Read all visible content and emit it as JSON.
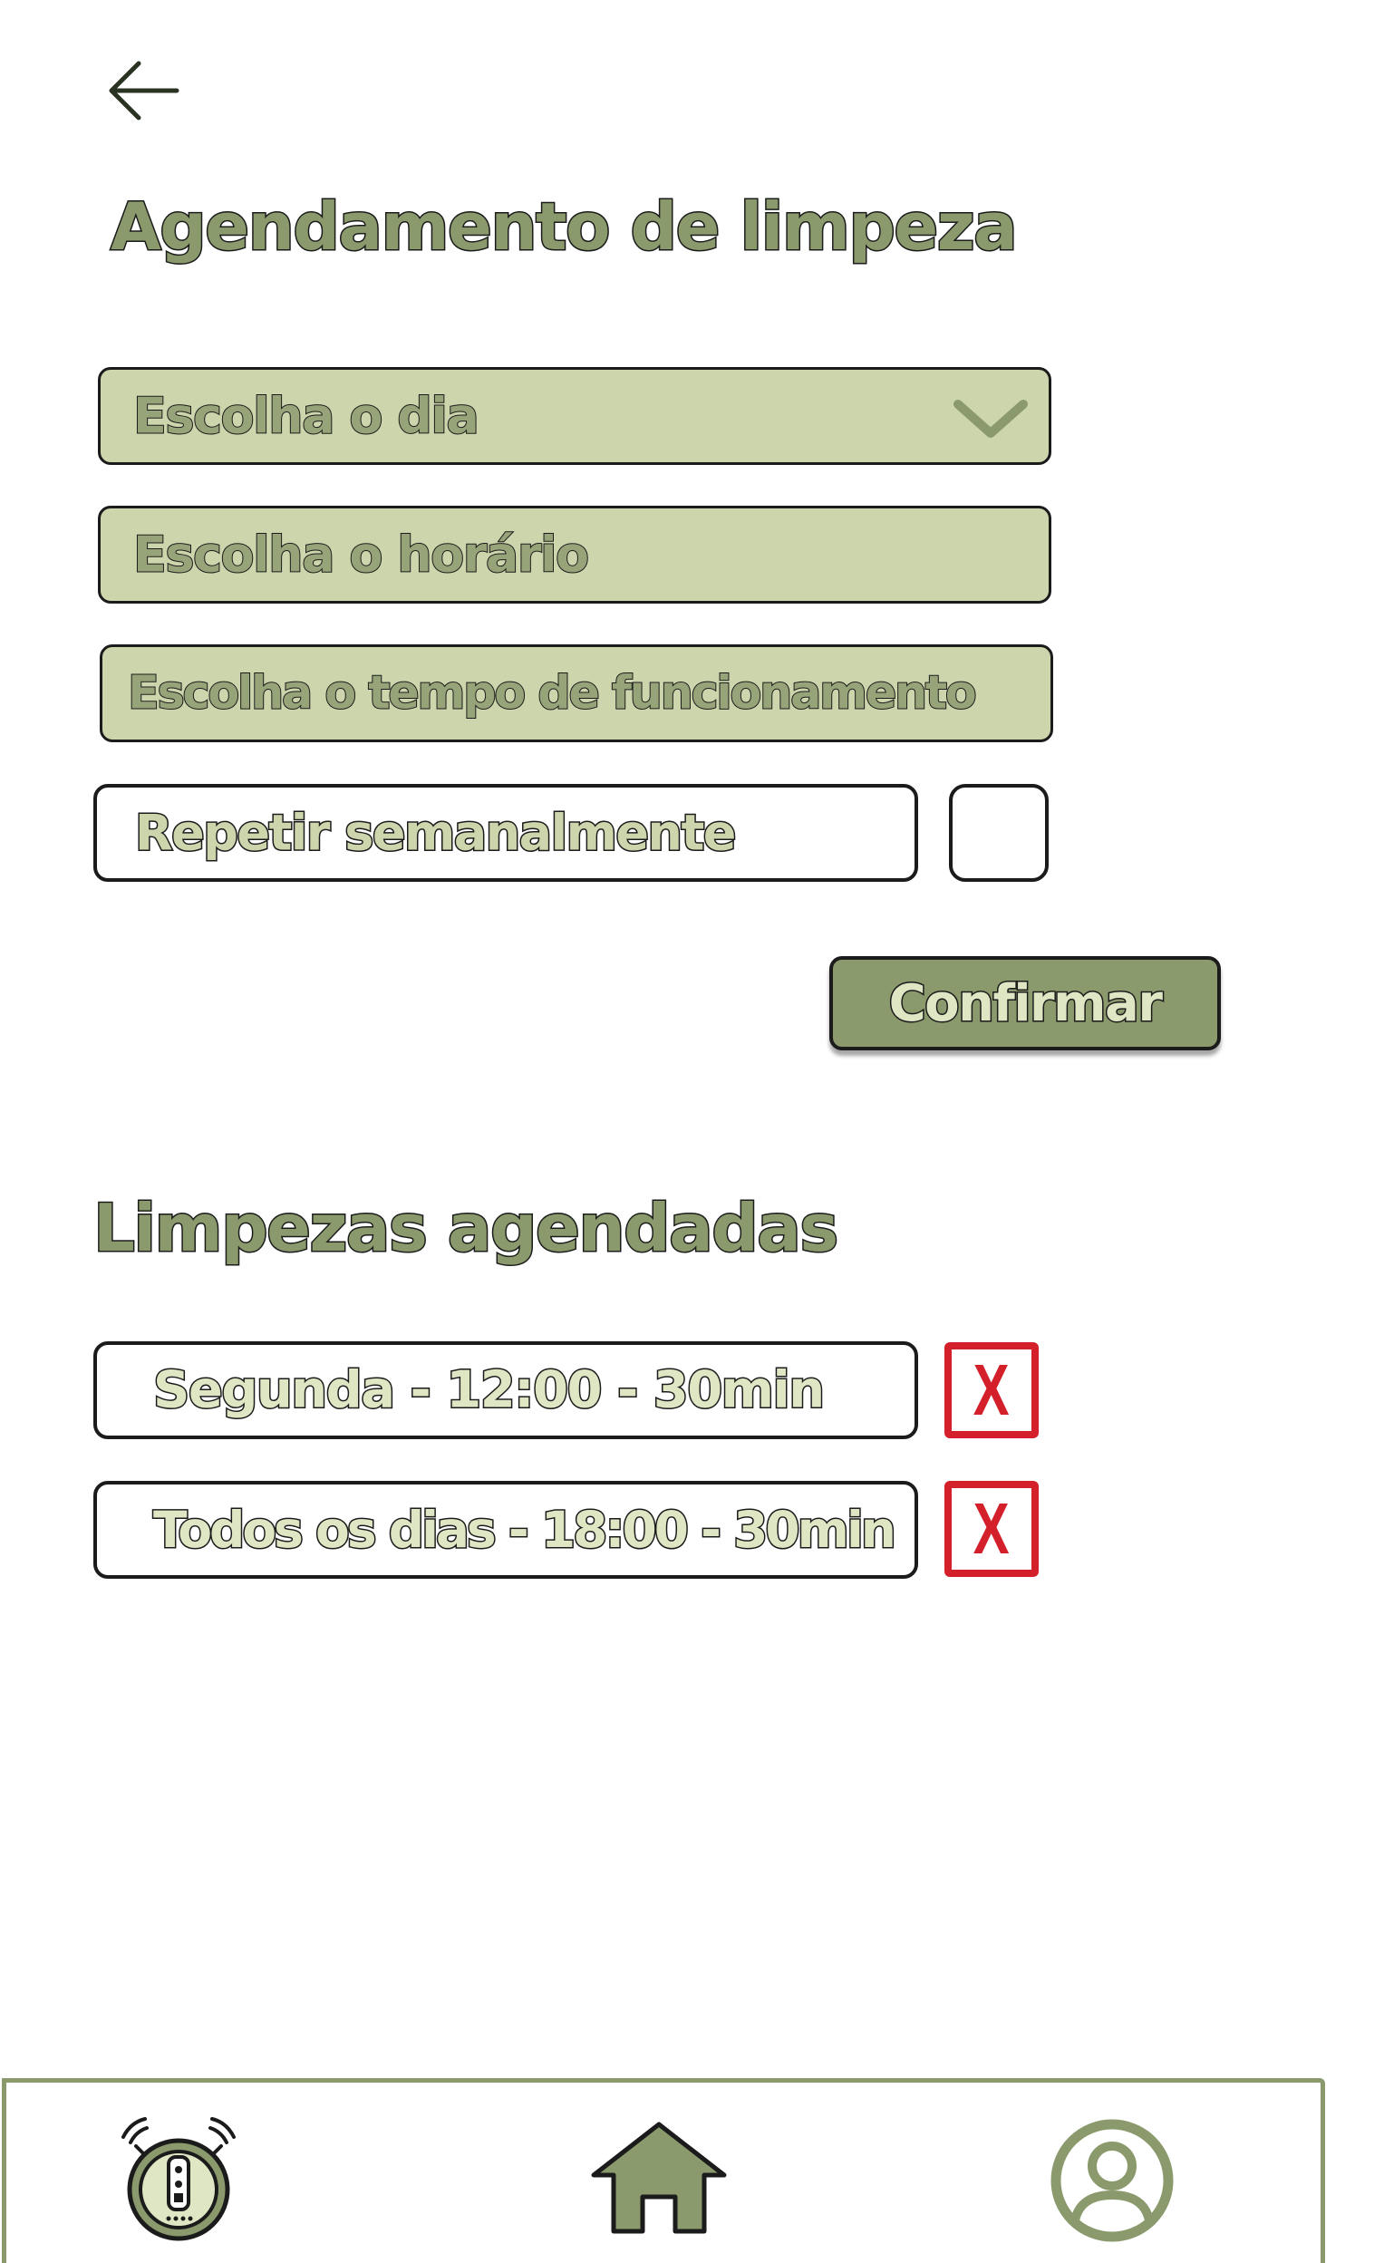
{
  "header": {
    "back_icon": "arrow-left-icon",
    "title": "Agendamento de limpeza"
  },
  "form": {
    "day_placeholder": "Escolha o dia",
    "time_placeholder": "Escolha o horário",
    "duration_placeholder": "Escolha o tempo de funcionamento",
    "repeat_label": "Repetir semanalmente",
    "repeat_checked": false,
    "confirm_label": "Confirmar"
  },
  "scheduled": {
    "title": "Limpezas agendadas",
    "items": [
      {
        "label": "Segunda - 12:00 - 30min",
        "delete_label": "X"
      },
      {
        "label": "Todos os dias - 18:00 - 30min",
        "delete_label": "X"
      }
    ]
  },
  "nav": {
    "items": [
      {
        "icon": "robot-vacuum-icon"
      },
      {
        "icon": "home-icon"
      },
      {
        "icon": "user-profile-icon"
      }
    ]
  },
  "colors": {
    "accent": "#8a9a6c",
    "field_bg": "#cdd5ad",
    "delete": "#d4202a",
    "outline": "#1b1b1b"
  }
}
